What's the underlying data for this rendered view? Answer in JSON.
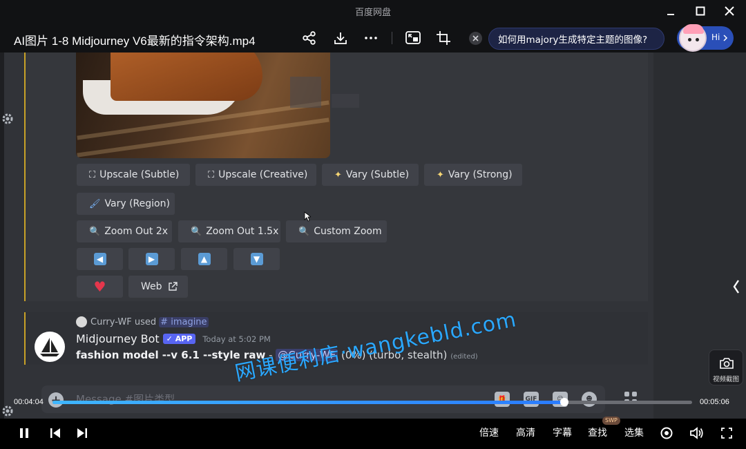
{
  "window": {
    "app_title": "百度网盘"
  },
  "header": {
    "video_title": "AI图片 1-8 Midjourney V6最新的指令架构.mp4",
    "ai_question": "如何用majory生成特定主题的图像?",
    "ai_greeting": "Hi"
  },
  "discord": {
    "buttons_row1": [
      {
        "label": "Upscale (Subtle)",
        "icon": "upscale-icon"
      },
      {
        "label": "Upscale (Creative)",
        "icon": "upscale-icon"
      },
      {
        "label": "Vary (Subtle)",
        "icon": "sparkle-icon"
      },
      {
        "label": "Vary (Strong)",
        "icon": "sparkle-icon"
      }
    ],
    "vary_region": {
      "label": "Vary (Region)",
      "icon": "brush-icon"
    },
    "zoom_buttons": [
      {
        "label": "Zoom Out 2x",
        "icon": "magnifier-icon"
      },
      {
        "label": "Zoom Out 1.5x",
        "icon": "magnifier-icon"
      },
      {
        "label": "Custom Zoom",
        "icon": "magnifier-icon"
      }
    ],
    "arrows": [
      "left-arrow-icon",
      "right-arrow-icon",
      "up-arrow-icon",
      "down-arrow-icon"
    ],
    "web_button": {
      "label": "Web"
    },
    "reply": {
      "user": "Curry-WF",
      "used": "used",
      "command": "imagine"
    },
    "bot": {
      "name": "Midjourney Bot",
      "badge": "APP",
      "time": "Today at 5:02 PM",
      "prompt": "fashion model --v 6.1 --style raw",
      "dash": " - ",
      "mention": "@Curry-WF",
      "status": " (0%) (turbo, stealth)",
      "edited": "(edited)"
    },
    "input": {
      "placeholder": "Message #图片类型",
      "gif_label": "GIF"
    }
  },
  "overlay": {
    "watermark": "网课便利店·wangkebld.com",
    "screenshot_label": "视频截图"
  },
  "progress": {
    "current": "00:04:04",
    "total": "00:05:06",
    "fraction": 0.8
  },
  "controls": {
    "speed": "倍速",
    "quality": "高清",
    "subtitles": "字幕",
    "search": "查找",
    "search_badge": "SWP",
    "episodes": "选集"
  },
  "colors": {
    "accent_blue": "#2a7bff",
    "discord_bg": "#313338",
    "blurple": "#5865f2",
    "gold_bar": "#c9a227"
  }
}
